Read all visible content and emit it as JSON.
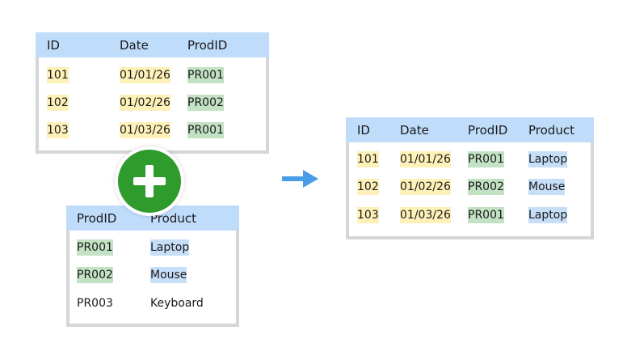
{
  "orders_table": {
    "headers": [
      "ID",
      "Date",
      "ProdID"
    ],
    "rows": [
      [
        "101",
        "01/01/26",
        "PR001"
      ],
      [
        "102",
        "01/02/26",
        "PR002"
      ],
      [
        "103",
        "01/03/26",
        "PR001"
      ]
    ]
  },
  "products_table": {
    "headers": [
      "ProdID",
      "Product"
    ],
    "rows": [
      [
        "PR001",
        "Laptop"
      ],
      [
        "PR002",
        "Mouse"
      ],
      [
        "PR003",
        "Keyboard"
      ]
    ]
  },
  "result_table": {
    "headers": [
      "ID",
      "Date",
      "ProdID",
      "Product"
    ],
    "rows": [
      [
        "101",
        "01/01/26",
        "PR001",
        "Laptop"
      ],
      [
        "102",
        "01/02/26",
        "PR002",
        "Mouse"
      ],
      [
        "103",
        "01/03/26",
        "PR001",
        "Laptop"
      ]
    ]
  },
  "icons": {
    "plus": "plus-icon",
    "arrow": "arrow-right-icon"
  },
  "colors": {
    "header": "#bfdcfb",
    "id_highlight": "#fdf1b8",
    "prodid_highlight": "#c3e2c4",
    "product_highlight": "#c7def9",
    "plus": "#2e9b2c",
    "arrow": "#4a9be8",
    "border": "#d6d6d6"
  }
}
